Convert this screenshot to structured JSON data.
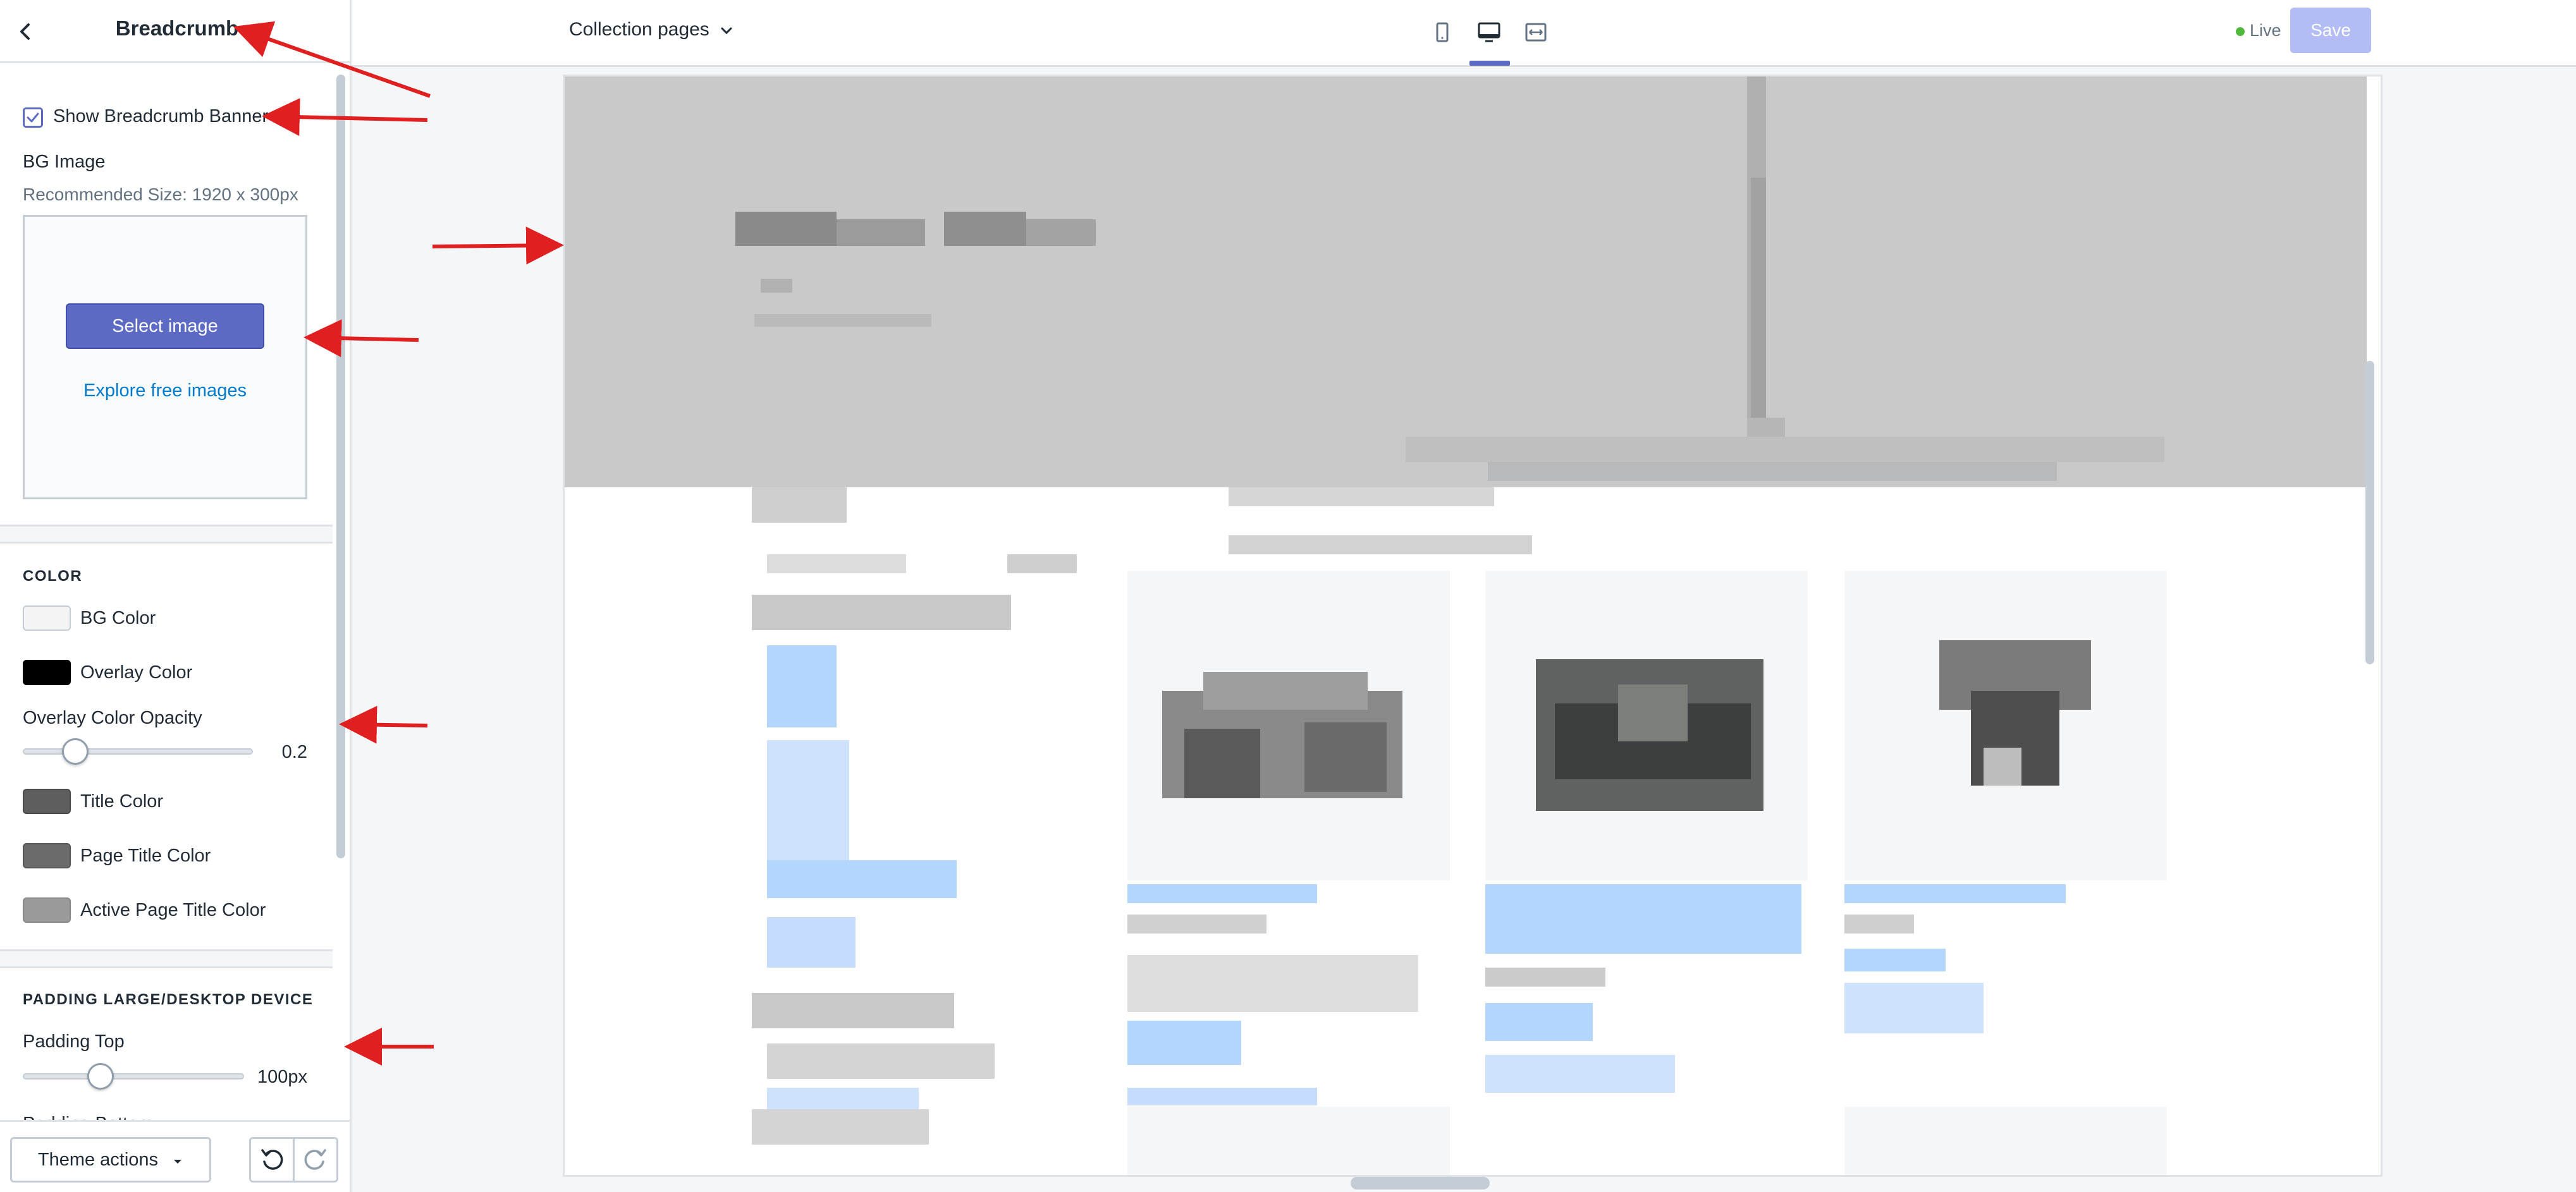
{
  "sidebar": {
    "title": "Breadcrumb",
    "show_banner_label": "Show Breadcrumb Banner",
    "show_banner_checked": true,
    "bg_image": {
      "label": "BG Image",
      "help": "Recommended Size: 1920 x 300px",
      "select_button": "Select image",
      "explore_link": "Explore free images"
    },
    "color_section": {
      "heading": "COLOR",
      "bg_color_label": "BG Color",
      "bg_color": "#f4f4f4",
      "overlay_color_label": "Overlay Color",
      "overlay_color": "#000000",
      "opacity_label": "Overlay Color Opacity",
      "opacity_value": "0.2",
      "opacity_fraction": 0.2,
      "title_color_label": "Title Color",
      "title_color": "#5e5e5e",
      "page_title_color_label": "Page Title Color",
      "page_title_color": "#6b6b6b",
      "active_page_title_color_label": "Active Page Title Color",
      "active_page_title_color": "#9a9a9a"
    },
    "padding_section": {
      "heading": "PADDING LARGE/DESKTOP DEVICE",
      "padding_top_label": "Padding Top",
      "padding_top_value": "100px",
      "padding_top_fraction": 0.33,
      "padding_bottom_label": "Padding Bottom"
    },
    "footer": {
      "theme_actions_label": "Theme actions"
    }
  },
  "topbar": {
    "page_selector": "Collection pages",
    "views": [
      "mobile-icon",
      "desktop-icon",
      "fullscreen-icon"
    ],
    "active_view": "desktop-icon",
    "status_label": "Live",
    "save_label": "Save"
  },
  "colors": {
    "accent": "#5c6ac4",
    "link": "#007ace",
    "live": "#50b83c",
    "annotation_arrow": "#e02020"
  }
}
